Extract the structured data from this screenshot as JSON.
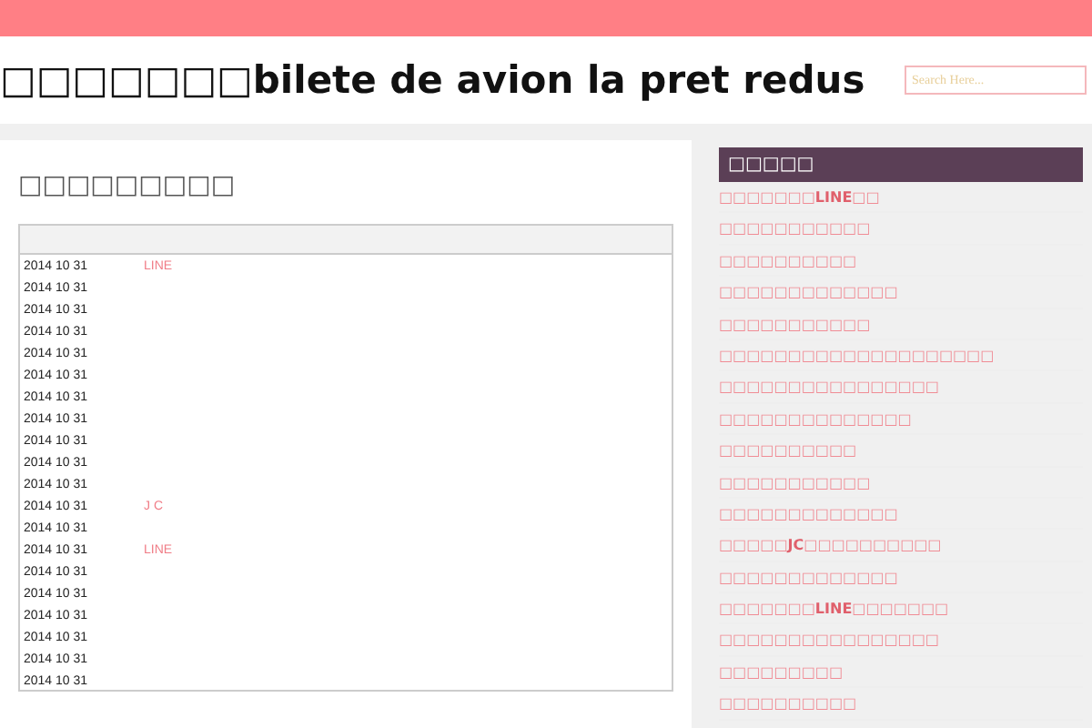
{
  "header": {
    "title": "□□□□□□□bilete de avion la pret redus",
    "search": {
      "placeholder": "Search Here..."
    }
  },
  "main": {
    "heading": "□□□□□□□□□",
    "rows": [
      {
        "date": "2014 10 31",
        "link": "LINE"
      },
      {
        "date": "2014 10 31"
      },
      {
        "date": "2014 10 31"
      },
      {
        "date": "2014 10 31"
      },
      {
        "date": "2014 10 31"
      },
      {
        "date": "2014 10 31"
      },
      {
        "date": "2014 10 31"
      },
      {
        "date": "2014 10 31"
      },
      {
        "date": "2014 10 31"
      },
      {
        "date": "2014 10 31"
      },
      {
        "date": "2014 10 31"
      },
      {
        "date": "2014 10 31",
        "link": "J C"
      },
      {
        "date": "2014 10 31"
      },
      {
        "date": "2014 10 31",
        "link": "LINE"
      },
      {
        "date": "2014 10 31"
      },
      {
        "date": "2014 10 31"
      },
      {
        "date": "2014 10 31"
      },
      {
        "date": "2014 10 31"
      },
      {
        "date": "2014 10 31"
      },
      {
        "date": "2014 10 31"
      }
    ]
  },
  "sidebar": {
    "heading": "□□□□□",
    "items": [
      "□□□□□□□**LINE**□□",
      "□□□□□□□□□□□",
      "□□□□□□□□□□",
      "□□□□□□□□□□□□□",
      "□□□□□□□□□□□",
      "□□□□□□□□□□□□□□□□□□□□",
      "□□□□□□□□□□□□□□□□",
      "□□□□□□□□□□□□□□",
      "□□□□□□□□□□",
      "□□□□□□□□□□□",
      "□□□□□□□□□□□□□",
      "□□□□□**JC**□□□□□□□□□□",
      "□□□□□□□□□□□□□",
      "□□□□□□□**LINE**□□□□□□□",
      "□□□□□□□□□□□□□□□□",
      "□□□□□□□□□",
      "□□□□□□□□□□"
    ]
  }
}
